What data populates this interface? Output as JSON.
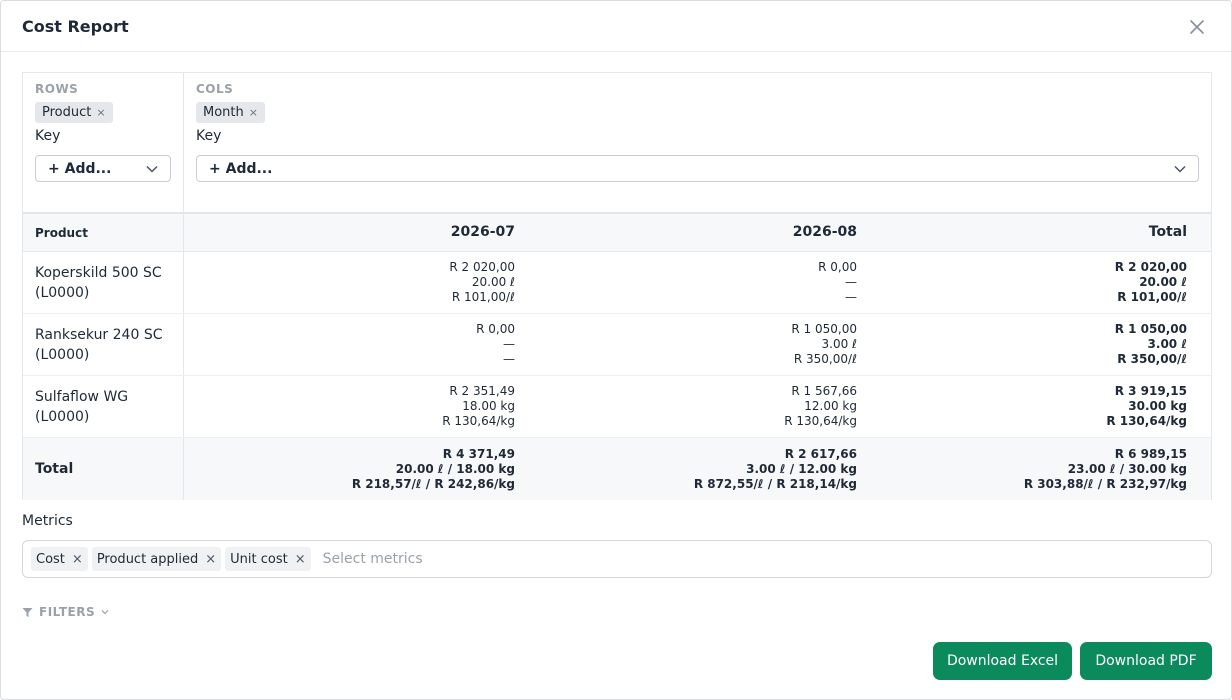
{
  "dialog": {
    "title": "Cost Report"
  },
  "config": {
    "rows_label": "ROWS",
    "cols_label": "COLS",
    "rows_chip": "Product",
    "cols_chip": "Month",
    "chip_remove": "×",
    "key_label": "Key",
    "add_label": "+ Add..."
  },
  "table": {
    "headers": {
      "first": "Product",
      "c1": "2026-07",
      "c2": "2026-08",
      "total": "Total"
    },
    "rows": [
      {
        "name": "Koperskild 500 SC (L0000)",
        "c1": [
          "R 2 020,00",
          "20.00 ℓ",
          "R 101,00/ℓ"
        ],
        "c2": [
          "R 0,00",
          "—",
          "—"
        ],
        "total": [
          "R 2 020,00",
          "20.00 ℓ",
          "R 101,00/ℓ"
        ]
      },
      {
        "name": "Ranksekur 240 SC (L0000)",
        "c1": [
          "R 0,00",
          "—",
          "—"
        ],
        "c2": [
          "R 1 050,00",
          "3.00 ℓ",
          "R 350,00/ℓ"
        ],
        "total": [
          "R 1 050,00",
          "3.00 ℓ",
          "R 350,00/ℓ"
        ]
      },
      {
        "name": "Sulfaflow WG (L0000)",
        "c1": [
          "R 2 351,49",
          "18.00 kg",
          "R 130,64/kg"
        ],
        "c2": [
          "R 1 567,66",
          "12.00 kg",
          "R 130,64/kg"
        ],
        "total": [
          "R 3 919,15",
          "30.00 kg",
          "R 130,64/kg"
        ]
      }
    ],
    "total_row": {
      "name": "Total",
      "c1": [
        "R 4 371,49",
        "20.00 ℓ / 18.00 kg",
        "R 218,57/ℓ / R 242,86/kg"
      ],
      "c2": [
        "R 2 617,66",
        "3.00 ℓ / 12.00 kg",
        "R 872,55/ℓ / R 218,14/kg"
      ],
      "total": [
        "R 6 989,15",
        "23.00 ℓ / 30.00 kg",
        "R 303,88/ℓ / R 232,97/kg"
      ]
    }
  },
  "metrics": {
    "label": "Metrics",
    "chips": [
      "Cost",
      "Product applied",
      "Unit cost"
    ],
    "remove": "×",
    "placeholder": "Select metrics"
  },
  "filters": {
    "label": "FILTERS"
  },
  "buttons": {
    "excel": "Download Excel",
    "pdf": "Download PDF"
  },
  "colors": {
    "accent": "#0b8a5c",
    "header_bg": "#f7f8f9",
    "muted": "#9aa1ab"
  },
  "icons": {
    "close": "close-icon",
    "chevron": "chevron-down-icon",
    "filter": "filter-icon"
  }
}
